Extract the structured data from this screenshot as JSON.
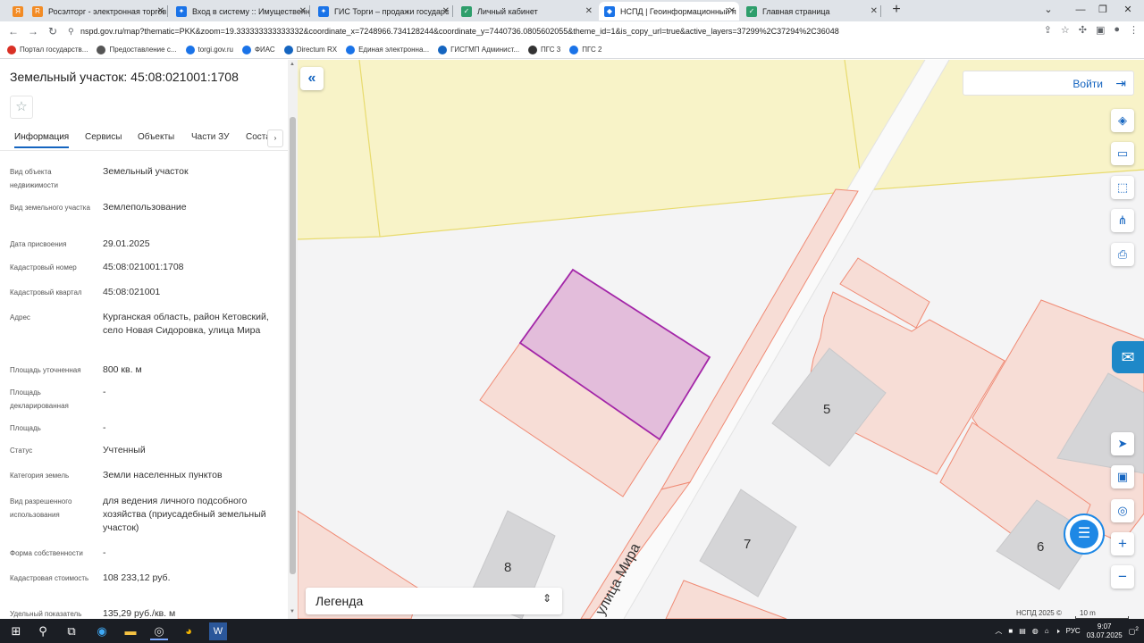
{
  "browser": {
    "tabs": [
      {
        "title": "Росэлторг - электронная торгов",
        "color": "#f28b25",
        "glyph": "R"
      },
      {
        "title": "Вход в систему :: Имущественн",
        "color": "#1a73e8",
        "glyph": "✦"
      },
      {
        "title": "ГИС Торги – продажи государс",
        "color": "#1a73e8",
        "glyph": "✦"
      },
      {
        "title": "Личный кабинет",
        "color": "#2e9e6b",
        "glyph": "✓"
      },
      {
        "title": "НСПД | Геоинформационный п",
        "color": "#1a73e8",
        "glyph": "◆"
      },
      {
        "title": "Главная страница",
        "color": "#2e9e6b",
        "glyph": "✓"
      }
    ],
    "url": "nspd.gov.ru/map?thematic=PKK&zoom=19.333333333333332&coordinate_x=7248966.734128244&coordinate_y=7440736.0805602055&theme_id=1&is_copy_url=true&active_layers=37299%2C37294%2C36048",
    "bookmarks": [
      {
        "label": "Портал государств...",
        "color": "#d93025"
      },
      {
        "label": "Предоставление с...",
        "color": "#555555"
      },
      {
        "label": "torgi.gov.ru",
        "color": "#1a73e8"
      },
      {
        "label": "ФИАС",
        "color": "#1a73e8"
      },
      {
        "label": "Directum RX",
        "color": "#1565c0"
      },
      {
        "label": "Единая электронна...",
        "color": "#1a73e8"
      },
      {
        "label": "ГИСГМП Админист...",
        "color": "#1565c0"
      },
      {
        "label": "ПГС 3",
        "color": "#333333"
      },
      {
        "label": "ПГС 2",
        "color": "#1a73e8"
      }
    ]
  },
  "panel": {
    "title": "Земельный участок: 45:08:021001:1708",
    "tabs": [
      "Информация",
      "Сервисы",
      "Объекты",
      "Части ЗУ",
      "Соста"
    ],
    "rows": [
      {
        "label": "Вид объекта недвижимости",
        "value": "Земельный участок"
      },
      {
        "label": "Вид земельного участка",
        "value": "Землепользование"
      },
      {
        "label": "Дата присвоения",
        "value": "29.01.2025"
      },
      {
        "label": "Кадастровый номер",
        "value": "45:08:021001:1708"
      },
      {
        "label": "Кадастровый квартал",
        "value": "45:08:021001"
      },
      {
        "label": "Адрес",
        "value": "Курганская область, район Кетовский, село Новая Сидоровка, улица Мира"
      },
      {
        "label": "Площадь уточненная",
        "value": "800 кв. м"
      },
      {
        "label": "Площадь декларированная",
        "value": "-"
      },
      {
        "label": "Площадь",
        "value": "-"
      },
      {
        "label": "Статус",
        "value": "Учтенный"
      },
      {
        "label": "Категория земель",
        "value": "Земли населенных пунктов"
      },
      {
        "label": "Вид разрешенного использования",
        "value": "для ведения личного подсобного хозяйства (приусадебный земельный участок)"
      },
      {
        "label": "Форма собственности",
        "value": "-"
      },
      {
        "label": "Кадастровая стоимость",
        "value": "108 233,12 руб."
      },
      {
        "label": "Удельный показатель",
        "value": "135,29 руб./кв. м"
      }
    ]
  },
  "map": {
    "login_label": "Войти",
    "street_label": "улица Мира",
    "building_numbers": [
      "5",
      "7",
      "8",
      "6"
    ],
    "legend_label": "Легенда",
    "copyright": "НСПД 2025 ©",
    "scale_label": "10 m",
    "colors": {
      "selected_fill": "#e3bddb",
      "selected_stroke": "#a326a8",
      "parcel_stroke": "#f08a74",
      "parcel_fill": "#f7ddd6",
      "zone_fill": "#f8f3c8",
      "building_fill": "#d5d5d7"
    }
  },
  "taskbar": {
    "language": "РУС",
    "time": "9:07",
    "date": "03.07.2025",
    "notifications": "2"
  }
}
